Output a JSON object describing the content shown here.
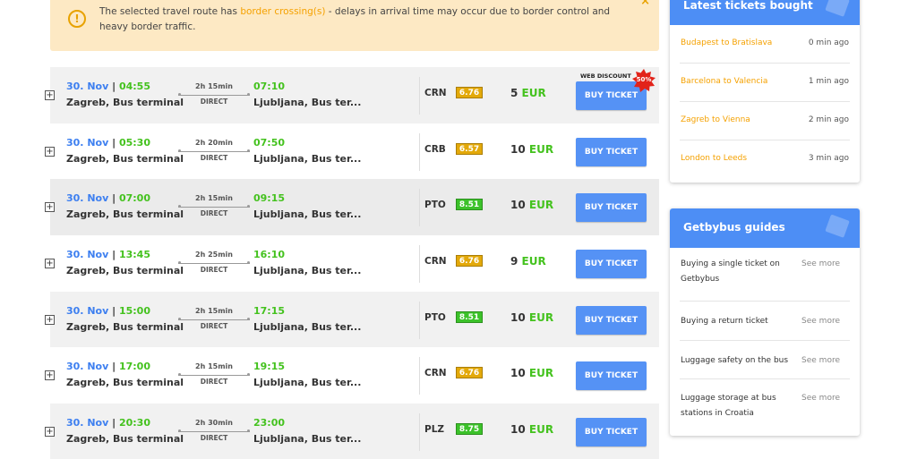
{
  "alert": {
    "text_before": "The selected travel route has ",
    "link": "border crossing(s)",
    "text_after": " - delays in arrival time may occur due to border control and heavy border traffic.",
    "close": "×"
  },
  "routes": [
    {
      "date": "30. Nov",
      "sep": "|",
      "dep_time": "04:55",
      "dep_stop": "Zagreb, Bus terminal",
      "duration": "2h 15min",
      "type": "DIRECT",
      "arr_time": "07:10",
      "arr_stop": "Ljubljana, Bus ter...",
      "carrier": "CRN",
      "rating": "6.76",
      "rating_color": "#e3a90a",
      "price": "5",
      "currency": "EUR",
      "buy": "BUY TICKET",
      "web_discount": "WEB DISCOUNT",
      "discount": "50%"
    },
    {
      "date": "30. Nov",
      "sep": "|",
      "dep_time": "05:30",
      "dep_stop": "Zagreb, Bus terminal",
      "duration": "2h 20min",
      "type": "DIRECT",
      "arr_time": "07:50",
      "arr_stop": "Ljubljana, Bus ter...",
      "carrier": "CRB",
      "rating": "6.57",
      "rating_color": "#e3a90a",
      "price": "10",
      "currency": "EUR",
      "buy": "BUY TICKET"
    },
    {
      "date": "30. Nov",
      "sep": "|",
      "dep_time": "07:00",
      "dep_stop": "Zagreb, Bus terminal",
      "duration": "2h 15min",
      "type": "DIRECT",
      "arr_time": "09:15",
      "arr_stop": "Ljubljana, Bus ter...",
      "carrier": "PTO",
      "rating": "8.51",
      "rating_color": "#3cc22a",
      "price": "10",
      "currency": "EUR",
      "buy": "BUY TICKET"
    },
    {
      "date": "30. Nov",
      "sep": "|",
      "dep_time": "13:45",
      "dep_stop": "Zagreb, Bus terminal",
      "duration": "2h 25min",
      "type": "DIRECT",
      "arr_time": "16:10",
      "arr_stop": "Ljubljana, Bus ter...",
      "carrier": "CRN",
      "rating": "6.76",
      "rating_color": "#e3a90a",
      "price": "9",
      "currency": "EUR",
      "buy": "BUY TICKET"
    },
    {
      "date": "30. Nov",
      "sep": "|",
      "dep_time": "15:00",
      "dep_stop": "Zagreb, Bus terminal",
      "duration": "2h 15min",
      "type": "DIRECT",
      "arr_time": "17:15",
      "arr_stop": "Ljubljana, Bus ter...",
      "carrier": "PTO",
      "rating": "8.51",
      "rating_color": "#3cc22a",
      "price": "10",
      "currency": "EUR",
      "buy": "BUY TICKET"
    },
    {
      "date": "30. Nov",
      "sep": "|",
      "dep_time": "17:00",
      "dep_stop": "Zagreb, Bus terminal",
      "duration": "2h 15min",
      "type": "DIRECT",
      "arr_time": "19:15",
      "arr_stop": "Ljubljana, Bus ter...",
      "carrier": "CRN",
      "rating": "6.76",
      "rating_color": "#e3a90a",
      "price": "10",
      "currency": "EUR",
      "buy": "BUY TICKET"
    },
    {
      "date": "30. Nov",
      "sep": "|",
      "dep_time": "20:30",
      "dep_stop": "Zagreb, Bus terminal",
      "duration": "2h 30min",
      "type": "DIRECT",
      "arr_time": "23:00",
      "arr_stop": "Ljubljana, Bus ter...",
      "carrier": "PLZ",
      "rating": "8.75",
      "rating_color": "#3cc22a",
      "price": "10",
      "currency": "EUR",
      "buy": "BUY TICKET"
    }
  ],
  "latest": {
    "title": "Latest tickets bought",
    "items": [
      {
        "route": "Budapest to Bratislava",
        "ago": "0 min ago"
      },
      {
        "route": "Barcelona to Valencia",
        "ago": "1 min ago"
      },
      {
        "route": "Zagreb to Vienna",
        "ago": "2 min ago"
      },
      {
        "route": "London to Leeds",
        "ago": "3 min ago"
      }
    ]
  },
  "guides": {
    "title": "Getbybus guides",
    "items": [
      {
        "title": "Buying a single ticket on Getbybus",
        "more": "See more"
      },
      {
        "title": "Buying a return ticket",
        "more": "See more"
      },
      {
        "title": "Luggage safety on the bus",
        "more": "See more"
      },
      {
        "title": "Luggage storage at bus stations in Croatia",
        "more": "See more"
      }
    ]
  },
  "icons": {
    "alert": "warning-circle-icon",
    "expand": "plus-icon",
    "card_deco": "ticket-icon"
  }
}
